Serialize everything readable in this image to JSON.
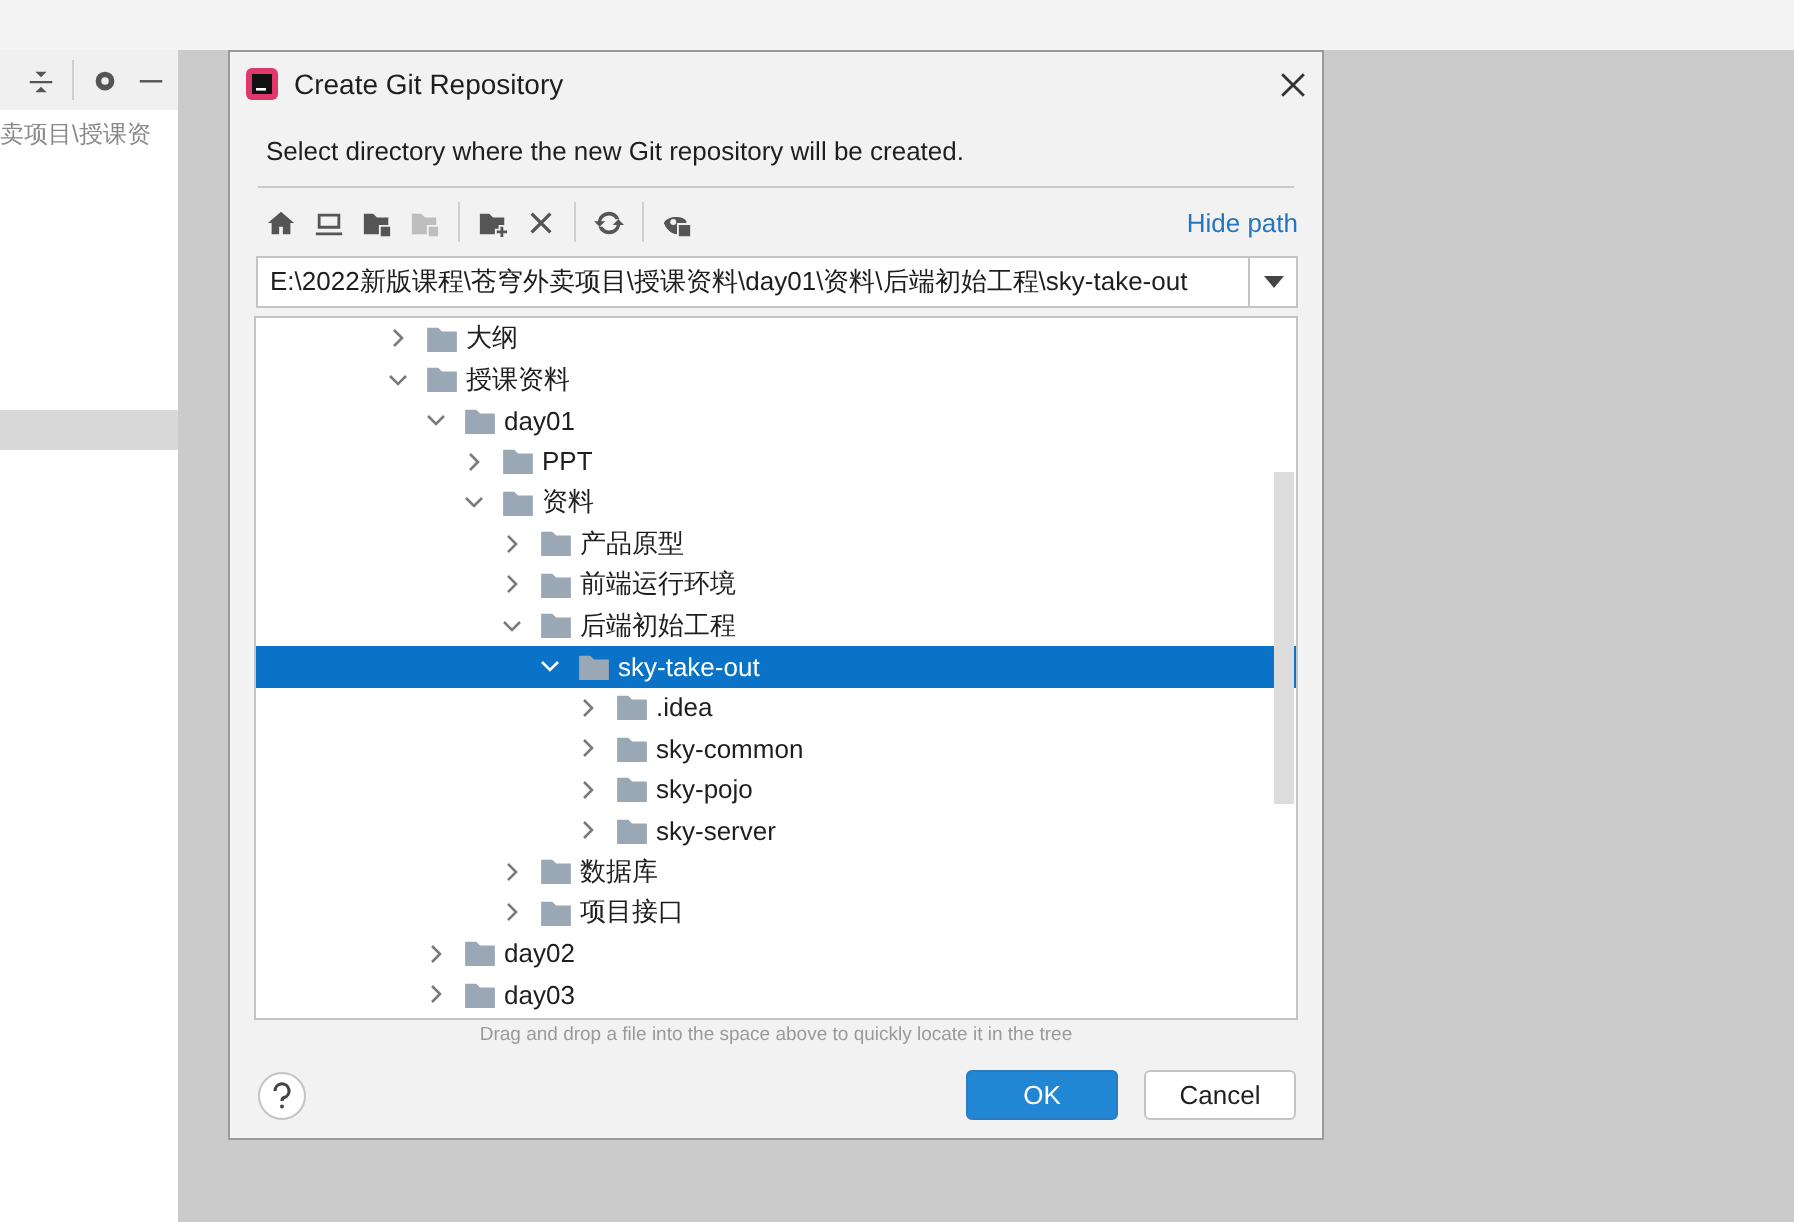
{
  "background_panel": {
    "path_text": "卖项目\\授课资"
  },
  "dialog": {
    "title": "Create Git Repository",
    "description": "Select directory where the new Git repository will be created.",
    "toolbar": {
      "hide_path_link": "Hide path"
    },
    "path_field": {
      "value": "E:\\2022新版课程\\苍穹外卖项目\\授课资料\\day01\\资料\\后端初始工程\\sky-take-out"
    },
    "tree": [
      {
        "label": "大纲",
        "expanded": false,
        "selected": false
      },
      {
        "label": "授课资料",
        "expanded": true,
        "selected": false,
        "children": [
          {
            "label": "day01",
            "expanded": true,
            "selected": false,
            "children": [
              {
                "label": "PPT",
                "expanded": false,
                "selected": false
              },
              {
                "label": "资料",
                "expanded": true,
                "selected": false,
                "children": [
                  {
                    "label": "产品原型",
                    "expanded": false,
                    "selected": false
                  },
                  {
                    "label": "前端运行环境",
                    "expanded": false,
                    "selected": false
                  },
                  {
                    "label": "后端初始工程",
                    "expanded": true,
                    "selected": false,
                    "children": [
                      {
                        "label": "sky-take-out",
                        "expanded": true,
                        "selected": true,
                        "children": [
                          {
                            "label": ".idea",
                            "expanded": false,
                            "selected": false
                          },
                          {
                            "label": "sky-common",
                            "expanded": false,
                            "selected": false
                          },
                          {
                            "label": "sky-pojo",
                            "expanded": false,
                            "selected": false
                          },
                          {
                            "label": "sky-server",
                            "expanded": false,
                            "selected": false
                          }
                        ]
                      }
                    ]
                  },
                  {
                    "label": "数据库",
                    "expanded": false,
                    "selected": false
                  },
                  {
                    "label": "项目接口",
                    "expanded": false,
                    "selected": false
                  }
                ]
              }
            ]
          },
          {
            "label": "day02",
            "expanded": false,
            "selected": false
          },
          {
            "label": "day03",
            "expanded": false,
            "selected": false
          }
        ]
      }
    ],
    "hint": "Drag and drop a file into the space above to quickly locate it in the tree",
    "buttons": [
      {
        "label": "OK",
        "kind": "primary"
      },
      {
        "label": "Cancel",
        "kind": "secondary"
      }
    ]
  }
}
